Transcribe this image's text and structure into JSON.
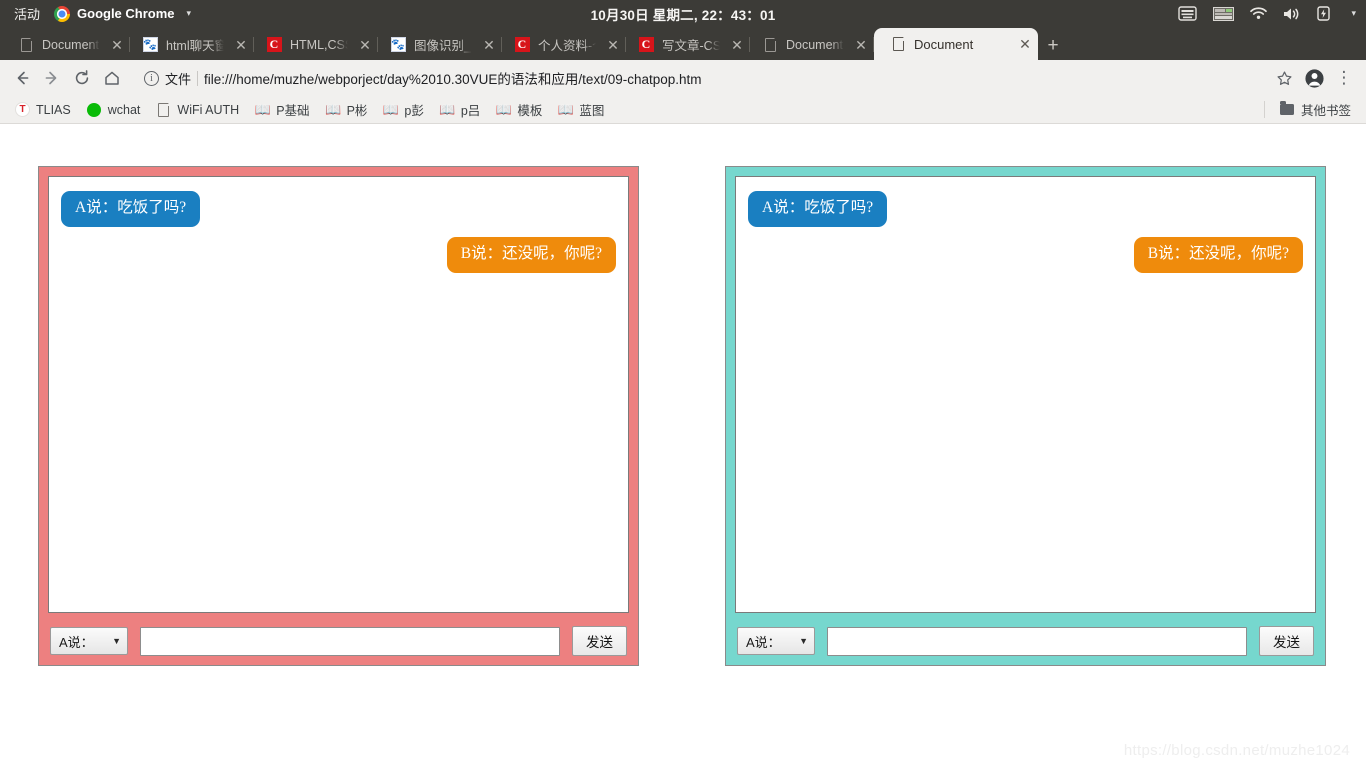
{
  "desktop": {
    "activities": "活动",
    "app_name": "Google Chrome",
    "app_menu_caret": "▾",
    "clock": "10月30日 星期二, 22：43：01",
    "tray_icons": [
      "on-screen-keyboard-icon",
      "keyboard-layout-icon",
      "wifi-icon",
      "volume-icon",
      "battery-icon",
      "system-menu-caret-icon"
    ]
  },
  "browser": {
    "tabs": [
      {
        "title": "Document",
        "favicon": "document-icon",
        "active": false,
        "close": "✕"
      },
      {
        "title": "html聊天窗口",
        "favicon": "baidu-icon",
        "active": false,
        "close": "✕"
      },
      {
        "title": "HTML,CSS,JS",
        "favicon": "csdn-icon",
        "active": false,
        "close": "✕"
      },
      {
        "title": "图像识别_百度",
        "favicon": "baidu-icon",
        "active": false,
        "close": "✕"
      },
      {
        "title": "个人资料-个人",
        "favicon": "csdn-icon",
        "active": false,
        "close": "✕"
      },
      {
        "title": "写文章-CSDN",
        "favicon": "csdn-icon",
        "active": false,
        "close": "✕"
      },
      {
        "title": "Document",
        "favicon": "document-icon",
        "active": false,
        "close": "✕"
      },
      {
        "title": "Document",
        "favicon": "document-icon",
        "active": true,
        "close": "✕"
      }
    ],
    "new_tab_label": "+",
    "toolbar": {
      "back": "←",
      "forward": "→",
      "reload": "⟳",
      "home": "⌂",
      "info_glyph": "i",
      "scheme_label": "文件",
      "url": "file:///home/muzhe/webporject/day%2010.30VUE的语法和应用/text/09-chatpop.htm",
      "bookmark_star": "☆",
      "profile": "profile-icon",
      "menu": "⋮"
    },
    "bookmarks": [
      {
        "label": "TLIAS",
        "icon": "tlias-icon"
      },
      {
        "label": "wchat",
        "icon": "wechat-icon"
      },
      {
        "label": "WiFi AUTH",
        "icon": "document-icon"
      },
      {
        "label": "P基础",
        "icon": "book-icon"
      },
      {
        "label": "P彬",
        "icon": "book-icon"
      },
      {
        "label": "p彭",
        "icon": "book-icon"
      },
      {
        "label": "p吕",
        "icon": "book-icon"
      },
      {
        "label": "模板",
        "icon": "book-icon"
      },
      {
        "label": "蓝图",
        "icon": "book-icon"
      }
    ],
    "other_bookmarks": {
      "label": "其他书签",
      "icon": "folder-icon"
    }
  },
  "page": {
    "panels": [
      {
        "theme": "pink",
        "background_color": "#ed8080",
        "messages": [
          {
            "side": "left",
            "speaker": "a",
            "text": "A说：吃饭了吗?",
            "color": "#1a7fc1"
          },
          {
            "side": "right",
            "speaker": "b",
            "text": "B说：还没呢，你呢?",
            "color": "#ef8b0c"
          }
        ],
        "select_value": "A说：",
        "select_caret": "▼",
        "input_value": "",
        "input_placeholder": "",
        "send_label": "发送"
      },
      {
        "theme": "teal",
        "background_color": "#76d7ce",
        "messages": [
          {
            "side": "left",
            "speaker": "a",
            "text": "A说：吃饭了吗?",
            "color": "#1a7fc1"
          },
          {
            "side": "right",
            "speaker": "b",
            "text": "B说：还没呢，你呢?",
            "color": "#ef8b0c"
          }
        ],
        "select_value": "A说：",
        "select_caret": "▼",
        "input_value": "",
        "input_placeholder": "",
        "send_label": "发送"
      }
    ],
    "watermark": "https://blog.csdn.net/muzhe1024"
  }
}
